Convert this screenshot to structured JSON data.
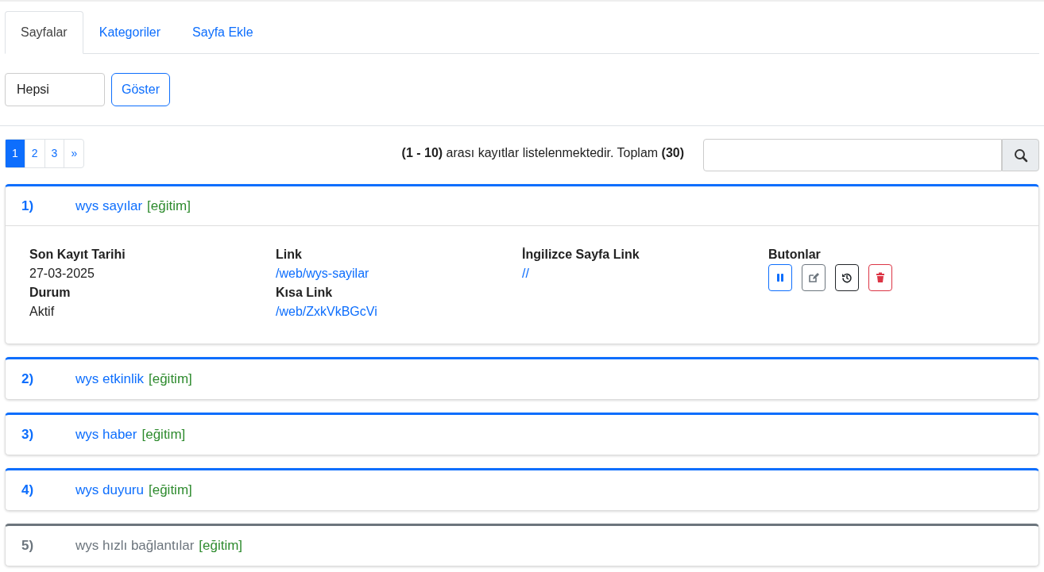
{
  "tabs": [
    {
      "label": "Sayfalar",
      "selected": true
    },
    {
      "label": "Kategoriler",
      "selected": false
    },
    {
      "label": "Sayfa Ekle",
      "selected": false
    }
  ],
  "filter": {
    "select_value": "Hepsi",
    "button": "Göster"
  },
  "pagination": [
    {
      "label": "1",
      "selected": true
    },
    {
      "label": "2",
      "selected": false
    },
    {
      "label": "3",
      "selected": false
    },
    {
      "label": "»",
      "selected": false
    }
  ],
  "summary": "**(1 - 10)** arası kayıtlar listelenmektedir. Toplam **(30)**",
  "pages": [
    {
      "number": "1)",
      "title": "wys sayılar",
      "category": "[eğitim]",
      "active": true,
      "expanded": true,
      "columns": [
        {
          "fields": [
            {
              "label": "Son Kayıt Tarihi",
              "value": "27-03-2025",
              "kind": "text"
            },
            {
              "label": "Durum",
              "value": "Aktif",
              "kind": "text"
            }
          ]
        },
        {
          "fields": [
            {
              "label": "Link",
              "value": "/web/wys-sayilar",
              "kind": "link"
            },
            {
              "label": "Kısa Link",
              "value": "/web/ZxkVkBGcVi",
              "kind": "link"
            }
          ]
        },
        {
          "fields": [
            {
              "label": "İngilizce Sayfa Link",
              "value": "//",
              "kind": "link"
            }
          ]
        }
      ],
      "buttons_label": "Butonlar",
      "buttons": [
        {
          "kind": "pause"
        },
        {
          "kind": "edit"
        },
        {
          "kind": "history"
        },
        {
          "kind": "delete"
        }
      ]
    },
    {
      "number": "2)",
      "title": "wys etkinlik",
      "category": "[eğitim]",
      "active": true,
      "expanded": false
    },
    {
      "number": "3)",
      "title": "wys haber",
      "category": "[eğitim]",
      "active": true,
      "expanded": false
    },
    {
      "number": "4)",
      "title": "wys duyuru",
      "category": "[eğitim]",
      "active": true,
      "expanded": false
    },
    {
      "number": "5)",
      "title": "wys hızlı bağlantılar",
      "category": "[eğitim]",
      "active": false,
      "expanded": false
    }
  ]
}
